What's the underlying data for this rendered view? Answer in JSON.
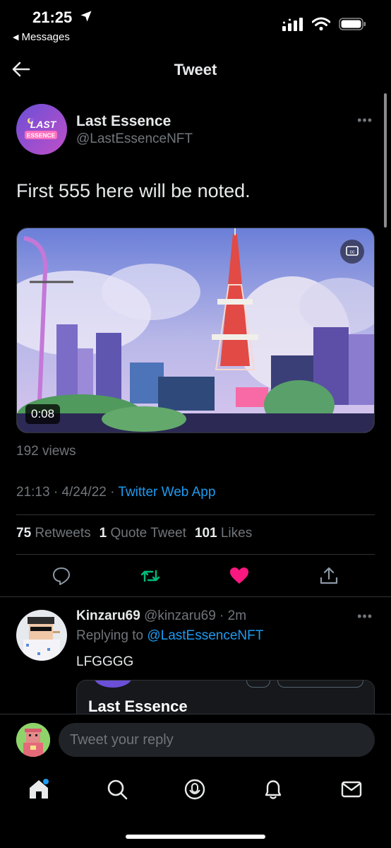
{
  "status_bar": {
    "time": "21:25",
    "back_app": "Messages"
  },
  "nav": {
    "title": "Tweet"
  },
  "tweet": {
    "author_name": "Last Essence",
    "author_handle": "@LastEssenceNFT",
    "avatar_text_top": "LAST",
    "avatar_text_bottom": "ESSENCE",
    "text": "First 555 here will be noted.",
    "video_duration": "0:08",
    "views": "192 views",
    "time": "21:13",
    "date": "4/24/22",
    "source": "Twitter Web App",
    "retweets_count": "75",
    "retweets_label": "Retweets",
    "quote_count": "1",
    "quote_label": "Quote Tweet",
    "likes_count": "101",
    "likes_label": "Likes"
  },
  "reply": {
    "name": "Kinzaru69",
    "handle": "@kinzaru69",
    "age": "2m",
    "replying_prefix": "Replying to",
    "replying_to": "@LastEssenceNFT",
    "text": "LFGGGG",
    "quote_title": "Last Essence"
  },
  "composer": {
    "placeholder": "Tweet your reply"
  },
  "colors": {
    "accent": "#1d9bf0",
    "retweet": "#00ba7c",
    "like": "#f91880",
    "secondary": "#71767b"
  }
}
